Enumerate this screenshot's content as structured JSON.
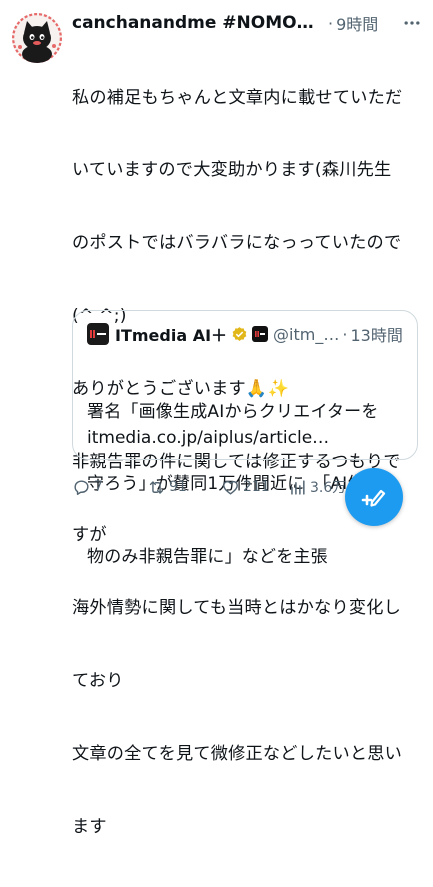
{
  "tweet": {
    "author_name": "canchanandme #NOMORE…",
    "separator": "·",
    "time": "9時間",
    "text_lines": [
      "私の補足もちゃんと文章内に載せていただ",
      "いていますので大変助かります(森川先生",
      "のポストではバラバラになっっていたので",
      "(^ ^;)",
      "ありがとうございます🙏✨",
      "非親告罪の件に関しては修正するつもりで",
      "すが",
      "海外情勢に関しても当時とはかなり変化し",
      "ており",
      "文章の全てを見て微修正などしたいと思い",
      "ます"
    ]
  },
  "quote": {
    "author_name": "ITmedia AI＋",
    "handle": "@itm_…",
    "separator": "·",
    "time": "13時間",
    "text_lines": [
      "署名「画像生成AIからクリエイターを",
      "守ろう」が賛同1万件間近に　「AI生成",
      "物のみ非親告罪に」などを主張"
    ],
    "link": "itmedia.co.jp/aiplus/article…"
  },
  "actions": {
    "reply_count": "7",
    "retweet_count": "91",
    "like_count": "211",
    "views_count": "3.6万"
  },
  "icons": {
    "more": "more-icon",
    "reply": "reply-icon",
    "retweet": "retweet-icon",
    "like": "heart-icon",
    "views": "views-icon",
    "compose": "compose-icon"
  },
  "colors": {
    "accent": "#1d9bf0",
    "muted": "#536471",
    "border": "#cfd9de",
    "verified_gold": "#e2b719"
  }
}
